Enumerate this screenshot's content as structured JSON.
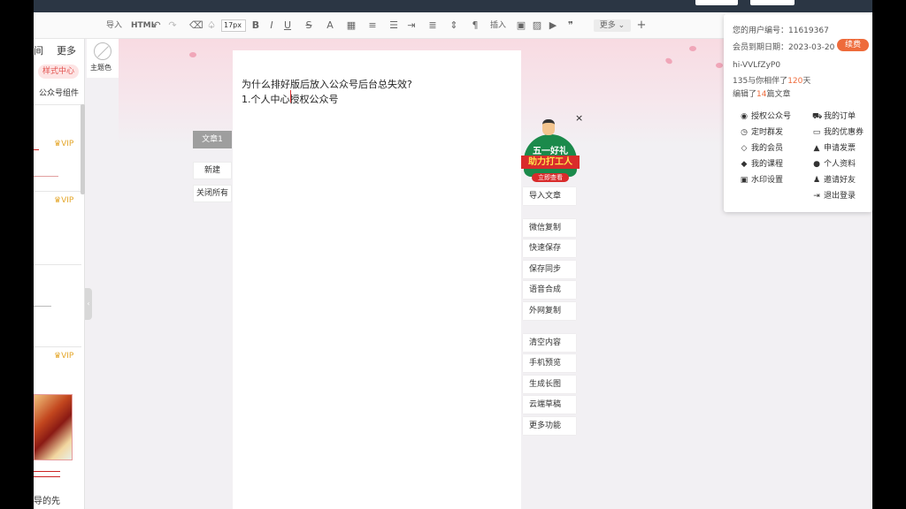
{
  "toolbar": {
    "import": "导入",
    "html": "HTML",
    "font_size": "17px",
    "insert": "插入",
    "more": "更多"
  },
  "left_panel": {
    "tab_left": "间",
    "tab_more": "更多",
    "style_center": "样式中心",
    "component": "公众号组件",
    "vip": "VIP",
    "footer_text": "导的先"
  },
  "theme": {
    "label": "主题色"
  },
  "document": {
    "tab": "文章1",
    "new": "新建",
    "close_all": "关闭所有"
  },
  "editor": {
    "line1": "为什么排好版后放入公众号后台总失效?",
    "line2": "1.个人中心授权公众号"
  },
  "promo": {
    "title1": "五一好礼",
    "title2": "助力打工人",
    "cta": "立即查看",
    "close": "×"
  },
  "right_actions": {
    "import_article": "导入文章",
    "wechat_copy": "微信复制",
    "quick_save": "快速保存",
    "save_sync": "保存同步",
    "tts": "语音合成",
    "external_copy": "外网复制",
    "clear": "清空内容",
    "mobile_preview": "手机预览",
    "long_image": "生成长图",
    "cloud_draft": "云端草稿",
    "more_functions": "更多功能"
  },
  "user_popup": {
    "user_id": "您的用户编号：11619367",
    "expiry": "会员到期日期：2023-03-20",
    "renew": "续费",
    "username": "hi-VVLfZyP0",
    "days_prefix": "135与你相伴了",
    "days": "120",
    "days_suffix": "天",
    "articles_prefix": "编辑了",
    "articles": "14",
    "articles_suffix": "篇文章",
    "menu": {
      "authorize": "授权公众号",
      "orders": "我的订单",
      "scheduled": "定时群发",
      "coupons": "我的优惠券",
      "members": "我的会员",
      "invoice": "申请发票",
      "courses": "我的课程",
      "profile": "个人资料",
      "watermark": "水印设置",
      "invite": "邀请好友",
      "logout": "退出登录"
    }
  },
  "colors": {
    "accent": "#ee6b3b",
    "topbar": "#2b3644",
    "vip": "#e4a629"
  }
}
